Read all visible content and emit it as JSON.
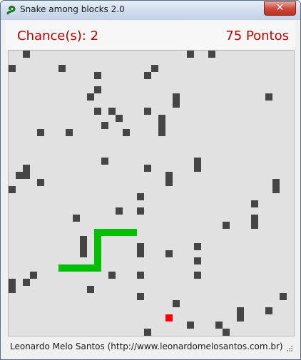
{
  "window": {
    "title": "Snake among blocks 2.0"
  },
  "header": {
    "chances": "Chance(s): 2",
    "points": "75 Pontos"
  },
  "status": {
    "text": "Leonardo Melo Santos (http://www.leonardomelosantos.com.br)"
  },
  "colors": {
    "snake": "#00c000",
    "food": "#ff0000",
    "block": "#454545",
    "board": "#e1e1e1",
    "hud_text": "#c00000"
  },
  "game": {
    "grid_size": 40,
    "blocks": [
      [
        2,
        0
      ],
      [
        25,
        0
      ],
      [
        28,
        0
      ],
      [
        0,
        2
      ],
      [
        7,
        2
      ],
      [
        20,
        2
      ],
      [
        12,
        3
      ],
      [
        19,
        3
      ],
      [
        12,
        5
      ],
      [
        11,
        6
      ],
      [
        23,
        6
      ],
      [
        36,
        6
      ],
      [
        23,
        7
      ],
      [
        12,
        8
      ],
      [
        14,
        8
      ],
      [
        19,
        8
      ],
      [
        15,
        9
      ],
      [
        21,
        9
      ],
      [
        13,
        10
      ],
      [
        21,
        10
      ],
      [
        4,
        11
      ],
      [
        8,
        11
      ],
      [
        16,
        11
      ],
      [
        21,
        11
      ],
      [
        13,
        15
      ],
      [
        26,
        15
      ],
      [
        2,
        16
      ],
      [
        19,
        16
      ],
      [
        26,
        16
      ],
      [
        1,
        17
      ],
      [
        2,
        17
      ],
      [
        22,
        17
      ],
      [
        4,
        18
      ],
      [
        22,
        18
      ],
      [
        37,
        18
      ],
      [
        0,
        19
      ],
      [
        37,
        19
      ],
      [
        18,
        20
      ],
      [
        34,
        21
      ],
      [
        15,
        22
      ],
      [
        18,
        22
      ],
      [
        9,
        23
      ],
      [
        34,
        23
      ],
      [
        30,
        24
      ],
      [
        34,
        24
      ],
      [
        10,
        26
      ],
      [
        10,
        27
      ],
      [
        18,
        27
      ],
      [
        26,
        27
      ],
      [
        10,
        28
      ],
      [
        18,
        28
      ],
      [
        22,
        28
      ],
      [
        26,
        29
      ],
      [
        3,
        31
      ],
      [
        14,
        31
      ],
      [
        18,
        31
      ],
      [
        26,
        31
      ],
      [
        0,
        32
      ],
      [
        2,
        32
      ],
      [
        0,
        33
      ],
      [
        11,
        33
      ],
      [
        18,
        34
      ],
      [
        38,
        34
      ],
      [
        23,
        35
      ],
      [
        32,
        36
      ],
      [
        36,
        36
      ],
      [
        32,
        37
      ],
      [
        25,
        38
      ],
      [
        29,
        38
      ],
      [
        19,
        39
      ],
      [
        30,
        39
      ]
    ],
    "snake": [
      [
        7,
        30
      ],
      [
        8,
        30
      ],
      [
        9,
        30
      ],
      [
        10,
        30
      ],
      [
        11,
        30
      ],
      [
        12,
        30
      ],
      [
        12,
        29
      ],
      [
        12,
        28
      ],
      [
        12,
        27
      ],
      [
        12,
        26
      ],
      [
        12,
        25
      ],
      [
        13,
        25
      ],
      [
        14,
        25
      ],
      [
        15,
        25
      ],
      [
        16,
        25
      ],
      [
        17,
        25
      ]
    ],
    "food": [
      22,
      37
    ]
  }
}
